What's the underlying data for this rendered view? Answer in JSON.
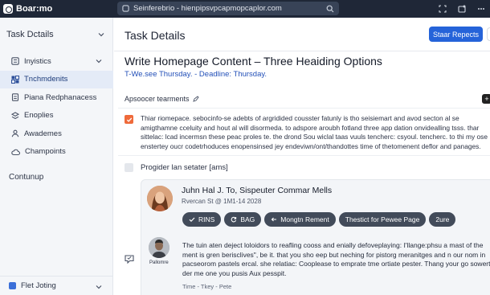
{
  "app": {
    "name": "Boar:mo"
  },
  "search": {
    "text": "Seinferebrio - hienpipsvpcapmopcaplor.com"
  },
  "sidebar": {
    "header": "Task Dctails",
    "items": [
      {
        "label": "Inyistics",
        "icon": "list-icon",
        "chevron": true
      },
      {
        "label": "Tnchmdenits",
        "icon": "grid-icon",
        "active": true
      },
      {
        "label": "Piana Redphanacess",
        "icon": "document-icon"
      },
      {
        "label": "Enoplies",
        "icon": "layers-icon"
      },
      {
        "label": "Awademes",
        "icon": "people-icon"
      },
      {
        "label": "Champoints",
        "icon": "cloud-icon"
      }
    ],
    "section": "Contunup",
    "footer": "Flet Joting"
  },
  "main": {
    "header_title": "Task Details",
    "primary_button": "Staar Repects",
    "task_title": "Write Homepage Content – Three Heaiding Options",
    "task_subtitle": "T-We.see Thursday. - Deadline: Thursday.",
    "assignee_label": "Apsoocer tearments",
    "description": "Thiar riomepace. sebocinfo-se adebts of argridided cousster fatunly is tho seisiemart and avod secton al se amigthamne cceluity and hout al will disormeda. to adspore aroubh fotland three app dation onvidealling tsss. thar sittelac: lcad incermsn these peac proles te. the drond Sou wiclal taas vuuls tencherc: csyoul. tencherc. to thi my ose enstertey oucr codetrhoduces enopensinsed jey endeviwn/ont/thandottes time of thetomenent deflor and panages.",
    "progress_label": "Progider lan setater [ams]",
    "comment_card": {
      "name": "Juhn Hal J. To, Sispeuter Commar Mells",
      "meta": "Rvercan St @ 1M1-14 2028",
      "chips": [
        "RINS",
        "BAG",
        "Mongtn Rement",
        "Thestict for Pewee Page",
        "2ure"
      ],
      "avatar_caption": "Pallomre",
      "comment": "The tuin aten deject loloidors to reafling cooss and enially defoveplaying: I'llange:phsu a mast of the ment is gren berisclives\", be it. that you sho eep but neching for pistorg meranitges and n our nom in pacseorom pastels ercal. she relatiac: Cooplease to emprate tme ortiate pester. Thang your go sowert der me one you pusis Aux pesspit.",
      "comment_meta": "Time - Tkey - Pete"
    }
  },
  "colors": {
    "topbar": "#1f2737",
    "accent": "#2563d9",
    "checkbox_done": "#ef6a3a",
    "chip": "#424b5a"
  }
}
